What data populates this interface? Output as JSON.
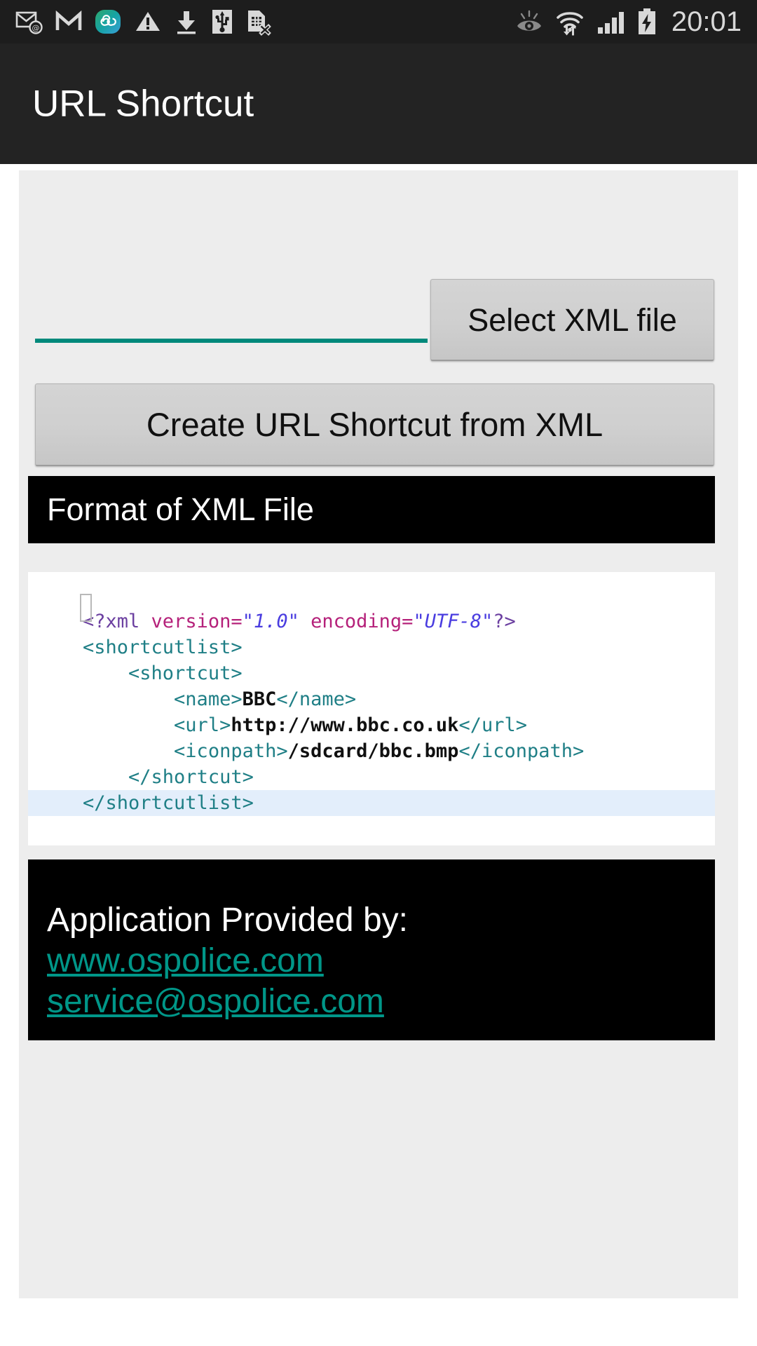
{
  "status_bar": {
    "icons": [
      "unread-email-icon",
      "gmail-icon",
      "infinity-app-icon",
      "warning-triangle-icon",
      "download-icon",
      "usb-connected-icon",
      "no-sim-card-icon"
    ],
    "right_icons": [
      "smart-stay-eye-icon",
      "wifi-data-transfer-icon",
      "cellular-signal-icon",
      "battery-charging-icon"
    ],
    "clock": "20:01"
  },
  "action_bar": {
    "title": "URL Shortcut"
  },
  "form": {
    "file_path_value": "",
    "file_path_placeholder": "",
    "select_button_label": "Select XML file",
    "create_button_label": "Create URL Shortcut from XML"
  },
  "format_section": {
    "header_label": "Format of XML File",
    "code_lines": [
      {
        "indent": 0,
        "highlight": false,
        "tokens": [
          {
            "cls": "t-pi",
            "text": "<?xml "
          },
          {
            "cls": "t-attr",
            "text": "version="
          },
          {
            "cls": "t-val",
            "text": "\"1.0\""
          },
          {
            "cls": "t-attr",
            "text": " encoding="
          },
          {
            "cls": "t-val",
            "text": "\"UTF-8\""
          },
          {
            "cls": "t-pi",
            "text": "?>"
          }
        ]
      },
      {
        "indent": 0,
        "highlight": false,
        "tokens": [
          {
            "cls": "t-tag",
            "text": "<shortcutlist>"
          }
        ]
      },
      {
        "indent": 4,
        "highlight": false,
        "tokens": [
          {
            "cls": "t-tag",
            "text": "<shortcut>"
          }
        ]
      },
      {
        "indent": 8,
        "highlight": false,
        "tokens": [
          {
            "cls": "t-tag",
            "text": "<name>"
          },
          {
            "cls": "t-text",
            "text": "BBC"
          },
          {
            "cls": "t-tag",
            "text": "</name>"
          }
        ]
      },
      {
        "indent": 8,
        "highlight": false,
        "tokens": [
          {
            "cls": "t-tag",
            "text": "<url>"
          },
          {
            "cls": "t-text",
            "text": "http://www.bbc.co.uk"
          },
          {
            "cls": "t-tag",
            "text": "</url>"
          }
        ]
      },
      {
        "indent": 8,
        "highlight": false,
        "tokens": [
          {
            "cls": "t-tag",
            "text": "<iconpath>"
          },
          {
            "cls": "t-text",
            "text": "/sdcard/bbc.bmp"
          },
          {
            "cls": "t-tag",
            "text": "</iconpath>"
          }
        ]
      },
      {
        "indent": 4,
        "highlight": false,
        "tokens": [
          {
            "cls": "t-tag",
            "text": "</shortcut>"
          }
        ]
      },
      {
        "indent": 0,
        "highlight": true,
        "tokens": [
          {
            "cls": "t-tag",
            "text": "</shortcutlist>"
          }
        ]
      }
    ]
  },
  "footer": {
    "title": "Application Provided by:",
    "website": "www.ospolice.com",
    "email": "service@ospolice.com"
  },
  "colors": {
    "accent_teal": "#009688",
    "input_underline": "#00897b",
    "action_bar_bg": "#232323",
    "status_bar_bg": "#1d1d1d",
    "panel_bg": "#ededed",
    "button_bg": "#cfcfcf",
    "black_card": "#000000",
    "code_highlight": "#e3eefb"
  }
}
